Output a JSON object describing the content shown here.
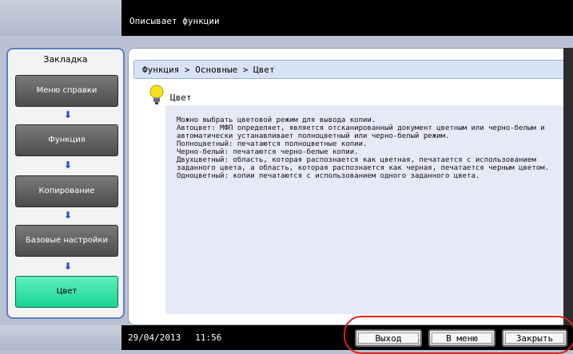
{
  "header": {
    "title": "Описывает функции"
  },
  "sidebar": {
    "title": "Закладка",
    "items": [
      {
        "label": "Меню справки"
      },
      {
        "label": "Функция"
      },
      {
        "label": "Копирование"
      },
      {
        "label": "Базовые настройки"
      },
      {
        "label": "Цвет"
      }
    ]
  },
  "main": {
    "breadcrumb": "Функция > Основные > Цвет",
    "section_title": "Цвет",
    "body": "Можно выбрать цветовой режим для вывода копии.\nАвтоцвет: МФП определяет, является отсканированный документ цветным или черно-белым и автоматически устанавливает полноцветный или черно-белый режим.\nПолноцветный: печатаются полноцветные копии.\nЧерно-белый: печатаются черно-белые копии.\nДвухцветный: область, которая распознается как цветная, печатается с использованием заданного цвета, а область, которая распознается как черная, печатается черным цветом.\nОдноцветный: копии печатаются с использованием одного заданного цвета."
  },
  "footer": {
    "date": "29/04/2013",
    "time": "11:56",
    "buttons": {
      "exit": "Выход",
      "menu": "В меню",
      "close": "Закрыть"
    }
  },
  "colors": {
    "active_item": "#19d493",
    "highlight": "#e02020",
    "arrow": "#1e4fd1"
  }
}
